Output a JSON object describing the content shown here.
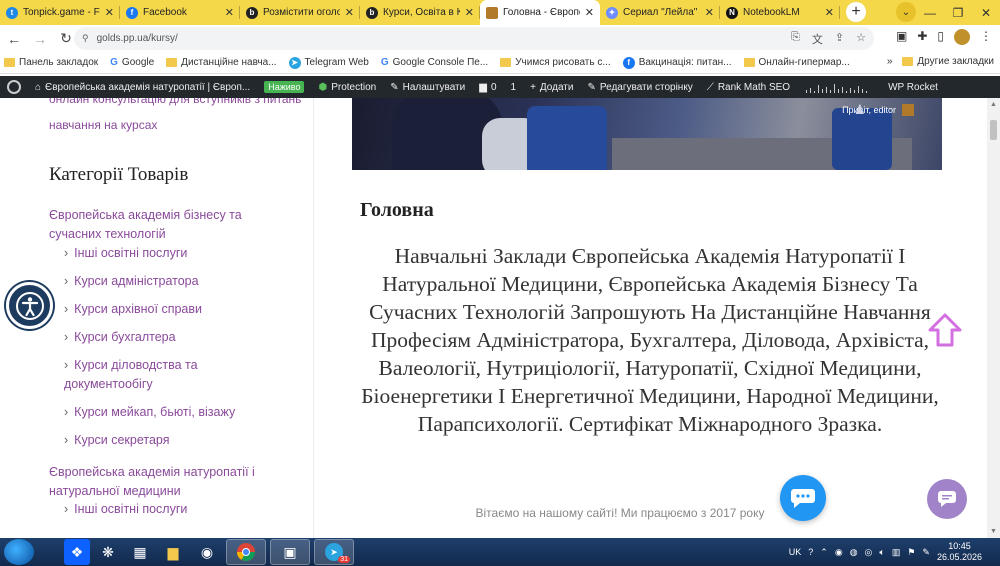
{
  "tabs": [
    {
      "title": "Tonpick.game - Fo",
      "favicon_color": "#1e88e5",
      "favicon": "t"
    },
    {
      "title": "Facebook",
      "favicon_color": "#1877f2",
      "favicon": "f"
    },
    {
      "title": "Розмістити оголо",
      "favicon_color": "#222222",
      "favicon": "b"
    },
    {
      "title": "Курси, Освіта в К",
      "favicon_color": "#222222",
      "favicon": "b"
    },
    {
      "title": "Головна - Європе",
      "favicon_color": "#b07a2a",
      "favicon": "",
      "active": true
    },
    {
      "title": "Сериал \"Лейла\" -",
      "favicon_color": "#6c8cff",
      "favicon": "✦"
    },
    {
      "title": "NotebookLM",
      "favicon_color": "#111111",
      "favicon": "N"
    }
  ],
  "address": {
    "url": "golds.pp.ua/kursy/"
  },
  "bookmarks": [
    {
      "label": "Панель закладок",
      "icon": "folder-icon"
    },
    {
      "label": "Google",
      "icon": "google-icon"
    },
    {
      "label": "Дистанційне навча...",
      "icon": "folder-icon"
    },
    {
      "label": "Telegram Web",
      "icon": "telegram-icon"
    },
    {
      "label": "Google Console Пе...",
      "icon": "google-icon"
    },
    {
      "label": "Учимся рисовать с...",
      "icon": "folder-icon"
    },
    {
      "label": "Вакцинація: питан...",
      "icon": "facebook-icon"
    },
    {
      "label": "Онлайн-гипермар...",
      "icon": "folder-icon"
    }
  ],
  "bookmarks_more": "»",
  "bookmarks_other": "Другие закладки",
  "wpbar": {
    "site": "Європейська академія натуропатії | Європ...",
    "live": "Наживо",
    "protection": "Protection",
    "customize": "Налаштувати",
    "comments": "0",
    "updates": "1",
    "add": "Додати",
    "edit": "Редагувати сторінку",
    "seo": "Rank Math SEO",
    "rocket": "WP Rocket"
  },
  "sidebar": {
    "top_line1": "онлайн консультацію для вступників з питань",
    "top_line2": "навчання на курсах",
    "categories_title": "Категорії Товарів",
    "items": [
      {
        "label": "Європейська академія бізнесу та сучасних технологій",
        "level": 0
      },
      {
        "label": "Інші освітні послуги",
        "level": 1
      },
      {
        "label": "Курси адміністратора",
        "level": 1
      },
      {
        "label": "Курси архівної справи",
        "level": 1
      },
      {
        "label": "Курси бухгалтера",
        "level": 1
      },
      {
        "label": "Курси діловодства та документообігу",
        "level": 1
      },
      {
        "label": "Курси мейкап, бьюті, візажу",
        "level": 1
      },
      {
        "label": "Курси секретаря",
        "level": 1
      },
      {
        "label": "Європейська академія натуропатії і натуральної медицини",
        "level": 0
      },
      {
        "label": "Інші освітні послуги",
        "level": 1
      }
    ]
  },
  "main": {
    "greeting": "Привіт, editor",
    "heading": "Головна",
    "body": "Навчальні Заклади Європейська Академія Натуропатії І Натуральної Медицини, Європейська Академія Бізнесу Та Сучасних Технологій Запрошують На Дистанційне Навчання Професіям Адміністратора, Бухгалтера, Діловода, Архівіста, Валеології, Нутриціології, Натуропатії, Східної Медицини, Біоенергетики І Енергетичної Медицини, Народної Медицини, Парапсихології. Сертифікат Міжнародного Зразка.",
    "welcome": "Вітаємо на нашому сайті! Ми працюємо з 2017 року"
  },
  "taskbar": {
    "lang": "UK",
    "time": "10:45",
    "date": "26.05.2026",
    "telegram_badge": "31"
  },
  "colors": {
    "link": "#8a4a9a",
    "tabstrip": "#f4d84a",
    "wpbar": "#23282d",
    "chat": "#2196f3"
  }
}
